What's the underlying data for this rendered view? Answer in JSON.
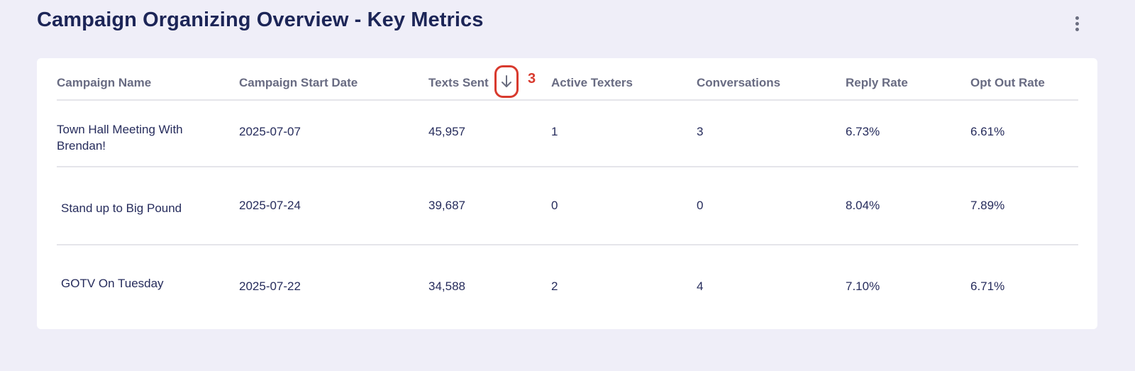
{
  "header": {
    "title": "Campaign Organizing Overview - Key Metrics",
    "menu_icon": "more-vertical-icon"
  },
  "table": {
    "columns": [
      "Campaign Name",
      "Campaign Start Date",
      "Texts Sent",
      "Active Texters",
      "Conversations",
      "Reply Rate",
      "Opt Out Rate"
    ],
    "sort": {
      "column": "Texts Sent",
      "direction": "descending",
      "icon": "arrow-down-icon"
    },
    "rows": [
      {
        "name": [
          "Town Hall Meeting With",
          "Brendan!"
        ],
        "start": "2025-07-07",
        "sent": "45,957",
        "texters": "1",
        "conversations": "3",
        "reply": "6.73%",
        "optout": "6.61%"
      },
      {
        "name": [
          "Stand up to Big Pound"
        ],
        "start": "2025-07-24",
        "sent": "39,687",
        "texters": "0",
        "conversations": "0",
        "reply": "8.04%",
        "optout": "7.89%"
      },
      {
        "name": [
          "GOTV On Tuesday"
        ],
        "start": "2025-07-22",
        "sent": "34,588",
        "texters": "2",
        "conversations": "4",
        "reply": "7.10%",
        "optout": "6.71%"
      }
    ]
  },
  "annotation": {
    "label": "3",
    "color": "#d83a2e"
  }
}
